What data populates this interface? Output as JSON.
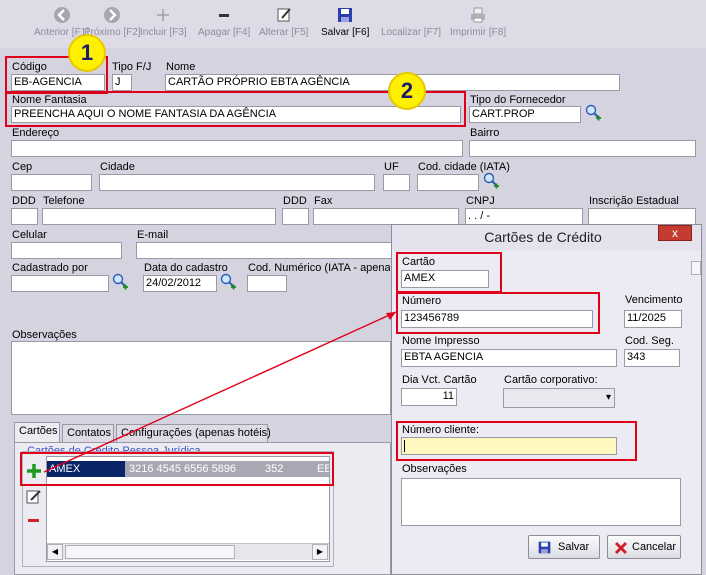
{
  "toolbar": {
    "anterior": "Anterior [F1]",
    "proximo": "Próximo [F2]",
    "incluir": "Incluir [F3]",
    "apagar": "Apagar [F4]",
    "alterar": "Alterar [F5]",
    "salvar": "Salvar [F6]",
    "localizar": "Localizar [F7]",
    "imprimir": "Imprimir [F8]"
  },
  "form": {
    "codigo_label": "Código",
    "codigo_value": "EB-AGENCIA",
    "tipo_label": "Tipo F/J",
    "tipo_value": "J",
    "nome_label": "Nome",
    "nome_value": "CARTÃO PRÓPRIO EBTA AGÊNCIA",
    "fantasia_label": "Nome Fantasia",
    "fantasia_value": "PREENCHA AQUI O NOME FANTASIA DA AGÊNCIA",
    "tipo_fornecedor_label": "Tipo do Fornecedor",
    "tipo_fornecedor_value": "CART.PROP",
    "endereco_label": "Endereço",
    "bairro_label": "Bairro",
    "cep_label": "Cep",
    "cidade_label": "Cidade",
    "uf_label": "UF",
    "cod_cidade_label": "Cod. cidade (IATA)",
    "ddd1_label": "DDD",
    "telefone_label": "Telefone",
    "ddd2_label": "DDD",
    "fax_label": "Fax",
    "cnpj_label": "CNPJ",
    "cnpj_value": "  .   .   /    -",
    "inscricao_label": "Inscrição Estadual",
    "celular_label": "Celular",
    "email_label": "E-mail",
    "cadastrado_label": "Cadastrado por",
    "data_cadastro_label": "Data do cadastro",
    "data_cadastro_value": "24/02/2012",
    "cod_numerico_label": "Cod. Numérico (IATA - apenas",
    "observacoes_label": "Observações"
  },
  "tabs": [
    "Cartões",
    "Contatos",
    "Configurações (apenas hotéis)"
  ],
  "cards_group": {
    "title": "Cartões de Crédito Pessoa Jurídica",
    "row": {
      "brand": "AMEX",
      "number": "3216 4545 6556 5896",
      "code": "352",
      "rest": "EB"
    }
  },
  "markers": {
    "one": "1",
    "two": "2"
  },
  "dialog": {
    "title": "Cartões de Crédito",
    "close": "x",
    "cartao_label": "Cartão",
    "cartao_value": "AMEX",
    "numero_label": "Número",
    "numero_value": "123456789",
    "vencimento_label": "Vencimento",
    "vencimento_value": "11/2025",
    "nome_impresso_label": "Nome Impresso",
    "nome_impresso_value": "EBTA AGENCIA",
    "cod_seg_label": "Cod. Seg.",
    "cod_seg_value": "343",
    "dia_vct_label": "Dia Vct. Cartão",
    "dia_vct_value": "11",
    "corporativo_label": "Cartão corporativo:",
    "numero_cliente_label": "Número cliente:",
    "numero_cliente_value": "",
    "obs_label": "Observações",
    "salvar": "Salvar",
    "cancelar": "Cancelar"
  },
  "colors": {
    "highlight": "#e0001a",
    "marker": "#ffef00",
    "selection": "#0a246a"
  }
}
